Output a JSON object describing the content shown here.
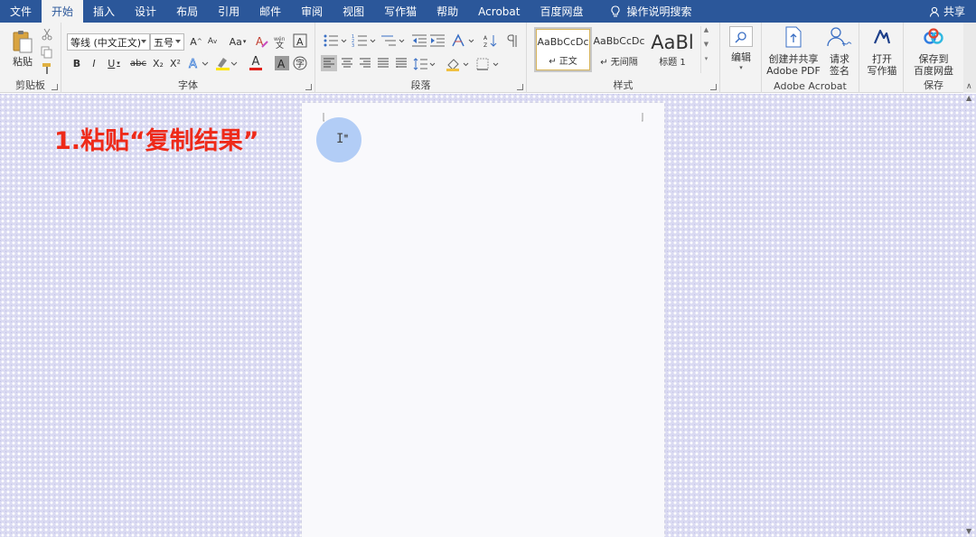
{
  "tabs": {
    "file": "文件",
    "home": "开始",
    "insert": "插入",
    "design": "设计",
    "layout": "布局",
    "references": "引用",
    "mailings": "邮件",
    "review": "审阅",
    "view": "视图",
    "writer_cat": "写作猫",
    "help": "帮助",
    "acrobat": "Acrobat",
    "baidu_pan": "百度网盘",
    "tell_me": "操作说明搜索",
    "share": "共享"
  },
  "ribbon": {
    "clipboard": {
      "paste": "粘贴",
      "label": "剪贴板"
    },
    "font": {
      "font_name": "等线 (中文正文)",
      "font_size": "五号",
      "grow": "A",
      "shrink": "A",
      "change_case": "Aa",
      "bold": "B",
      "italic": "I",
      "underline": "U",
      "strike": "abc",
      "subscript": "X₂",
      "superscript": "X²",
      "font_color_glyph": "A",
      "label": "字体"
    },
    "paragraph": {
      "label": "段落"
    },
    "styles": {
      "items": [
        {
          "sample": "AaBbCcDc",
          "name": "正文"
        },
        {
          "sample": "AaBbCcDc",
          "name": "无间隔"
        },
        {
          "sample": "AaBl",
          "name": "标题 1"
        }
      ],
      "label": "样式"
    },
    "editing": {
      "label": "编辑"
    },
    "acrobat": {
      "create_share_line1": "创建并共享",
      "create_share_line2": "Adobe PDF",
      "request_sign_line1": "请求",
      "request_sign_line2": "签名",
      "label": "Adobe Acrobat"
    },
    "writer": {
      "open_line1": "打开",
      "open_line2": "写作猫"
    },
    "save": {
      "line1": "保存到",
      "line2": "百度网盘",
      "label": "保存"
    }
  },
  "document": {
    "caption": "1.粘贴“复制结果”"
  },
  "colors": {
    "tab_bar": "#2b579a",
    "caption": "#ee2a1a",
    "cursor_highlight": "#78aaf0"
  }
}
